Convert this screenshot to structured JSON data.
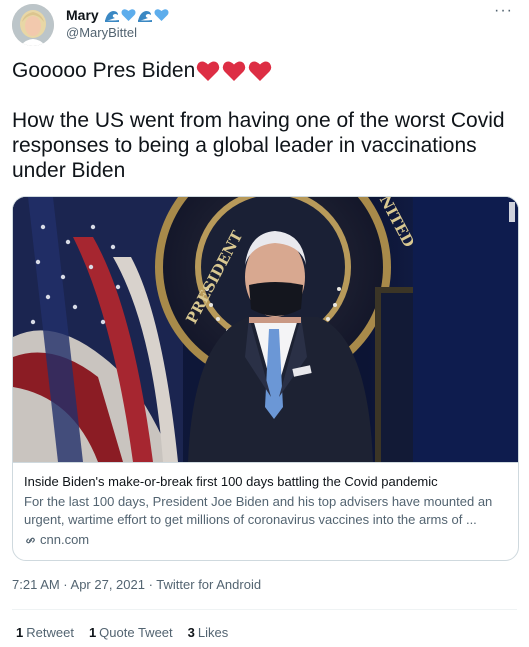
{
  "author": {
    "display_name": "Mary",
    "handle": "@MaryBittel",
    "name_emojis": [
      "wave-icon",
      "blue-heart-icon",
      "wave-icon",
      "blue-heart-icon"
    ]
  },
  "menu_glyph": "···",
  "tweet": {
    "line1": "Gooooo Pres Biden",
    "hearts": [
      "red-heart-icon",
      "red-heart-icon",
      "red-heart-icon"
    ],
    "line2": "How the US went from having one of the worst Covid",
    "line3": "responses to being a global leader in vaccinations",
    "line4": "under Biden"
  },
  "card": {
    "title": "Inside Biden's make-or-break first 100 days battling the Covid pandemic",
    "description_line1": "For the last 100 days, President Joe Biden and his top advisers have mounted an",
    "description_line2": "urgent, wartime effort to get millions of coronavirus vaccines into the arms of ...",
    "domain": "cnn.com",
    "seal_text": "PRESIDENT OF THE UNITED"
  },
  "meta": {
    "timestamp": "7:21 AM · Apr 27, 2021 · Twitter for Android"
  },
  "stats": {
    "retweets_count": "1",
    "retweets_label": "Retweet",
    "quotes_count": "1",
    "quotes_label": "Quote Tweet",
    "likes_count": "3",
    "likes_label": "Likes"
  },
  "colors": {
    "heart_red": "#dd2e44",
    "blue_heart": "#5dadec",
    "text": "#0f1419",
    "secondary": "#536471",
    "border": "#cfd9de"
  }
}
